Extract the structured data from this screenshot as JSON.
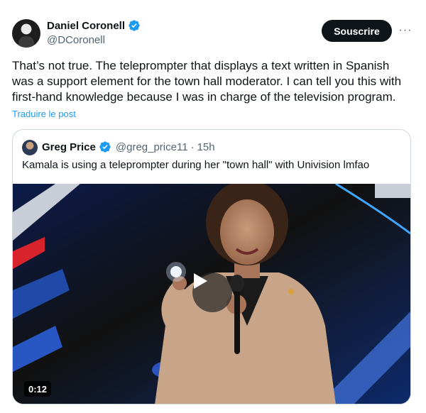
{
  "author": {
    "display_name": "Daniel Coronell",
    "handle": "@DCoronell"
  },
  "actions": {
    "subscribe_label": "Souscrire",
    "more_label": "···"
  },
  "tweet": {
    "text": "That’s not true. The teleprompter that displays a text written in Spanish was a support element for the town hall moderator. I can tell you this with first-hand knowledge because I was in charge of the television program.",
    "translate_label": "Traduire le post"
  },
  "quoted": {
    "display_name": "Greg Price",
    "handle": "@greg_price11",
    "separator": "·",
    "time": "15h",
    "text": "Kamala is using a teleprompter during her \"town hall\" with Univision lmfao",
    "video_duration": "0:12"
  },
  "colors": {
    "accent": "#1d9bf0",
    "text_primary": "#0f1419",
    "text_secondary": "#536471",
    "border": "#cfd9de",
    "verified": "#1d9bf0"
  }
}
